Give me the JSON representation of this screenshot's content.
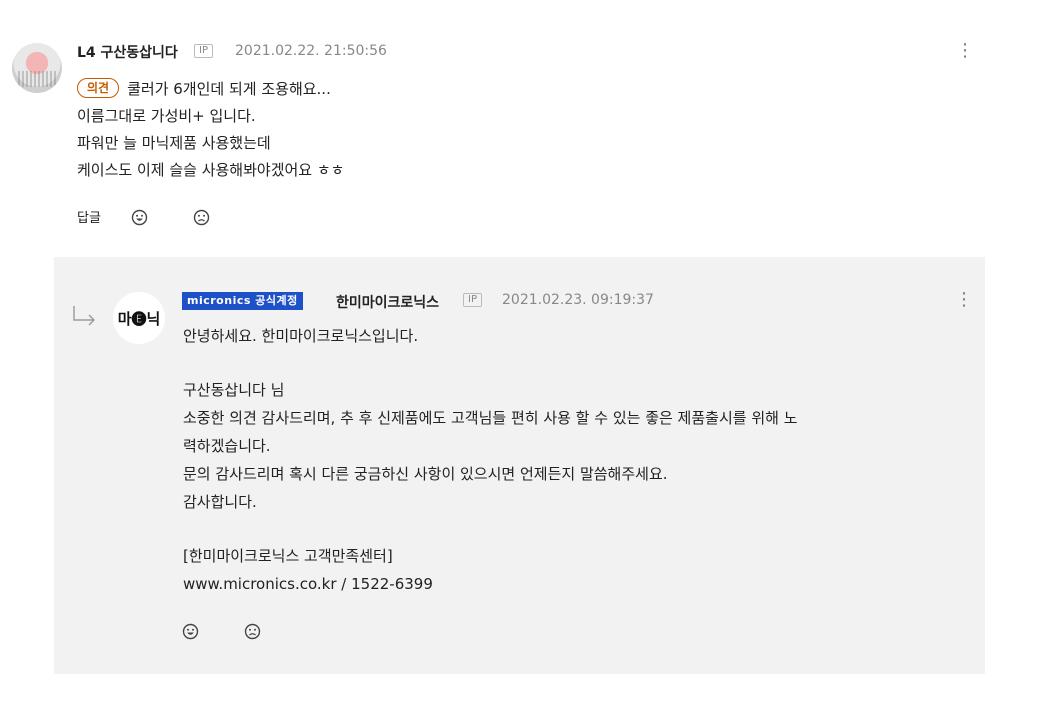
{
  "comment": {
    "level_name": "L4 구산동삽니다",
    "ip_label": "IP",
    "date": "2021.02.22. 21:50:56",
    "badge": "의견",
    "lines": [
      "쿨러가 6개인데 되게 조용해요...",
      "이름그대로 가성비+ 입니다.",
      "파워만 늘 마닉제품 사용했는데",
      "케이스도 이제 슬슬 사용해봐야겠어요 ㅎㅎ"
    ],
    "reply_label": "답글"
  },
  "reply": {
    "official_badge": "micronics 공식계정",
    "name": "한미마이크로닉스",
    "ip_label": "IP",
    "date": "2021.02.23. 09:19:37",
    "avatar_text": "마🅔닉",
    "lines": [
      "안녕하세요. 한미마이크로닉스입니다.",
      "",
      "구산동삽니다 님",
      "소중한 의견 감사드리며, 추 후 신제품에도 고객님들 편히 사용 할 수 있는 좋은 제품출시를 위해 노",
      "력하겠습니다.",
      "문의 감사드리며 혹시 다른 궁금하신 사항이 있으시면 언제든지 말씀해주세요.",
      "감사합니다.",
      "",
      "[한미마이크로닉스 고객만족센터]",
      "www.micronics.co.kr / 1522-6399"
    ]
  },
  "colors": {
    "accent_blue": "#1e50c8",
    "badge_orange": "#c35b00",
    "reply_bg": "#f2f2f2"
  }
}
